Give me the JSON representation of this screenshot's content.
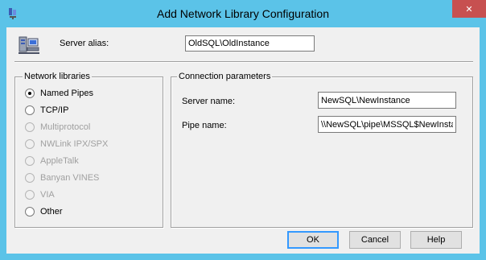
{
  "window": {
    "title": "Add Network Library Configuration",
    "close_glyph": "✕"
  },
  "alias": {
    "label": "Server alias:",
    "value": "OldSQL\\OldInstance"
  },
  "network_libraries": {
    "legend": "Network libraries",
    "options": [
      {
        "label": "Named Pipes",
        "checked": true,
        "enabled": true
      },
      {
        "label": "TCP/IP",
        "checked": false,
        "enabled": true
      },
      {
        "label": "Multiprotocol",
        "checked": false,
        "enabled": false
      },
      {
        "label": "NWLink IPX/SPX",
        "checked": false,
        "enabled": false
      },
      {
        "label": "AppleTalk",
        "checked": false,
        "enabled": false
      },
      {
        "label": "Banyan VINES",
        "checked": false,
        "enabled": false
      },
      {
        "label": "VIA",
        "checked": false,
        "enabled": false
      },
      {
        "label": "Other",
        "checked": false,
        "enabled": true
      }
    ]
  },
  "connection": {
    "legend": "Connection parameters",
    "server_name_label": "Server name:",
    "server_name_value": "NewSQL\\NewInstance",
    "pipe_name_label": "Pipe name:",
    "pipe_name_value": "\\\\NewSQL\\pipe\\MSSQL$NewInsta"
  },
  "buttons": {
    "ok": "OK",
    "cancel": "Cancel",
    "help": "Help"
  },
  "colors": {
    "titlebar": "#5bc3e8",
    "close": "#c75050",
    "face": "#f0f0f0"
  }
}
